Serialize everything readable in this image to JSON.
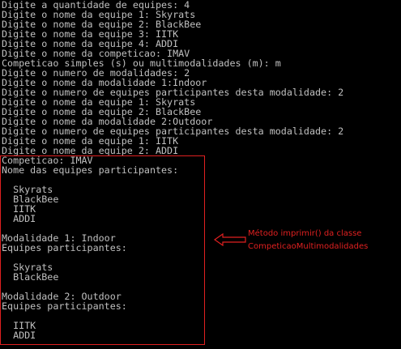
{
  "console": {
    "lines": [
      "Digite a quantidade de equipes: 4",
      "Digite o nome da equipe 1: Skyrats",
      "Digite o nome da equipe 2: BlackBee",
      "Digite o nome da equipe 3: IITK",
      "Digite o nome da equipe 4: ADDI",
      "Digite o nome da competicao: IMAV",
      "Competicao simples (s) ou multimodalidades (m): m",
      "Digite o numero de modalidades: 2",
      "Digite o nome da modalidade 1:Indoor",
      "Digite o numero de equipes participantes desta modalidade: 2",
      "Digite o nome da equipe 1: Skyrats",
      "Digite o nome da equipe 2: BlackBee",
      "Digite o nome da modalidade 2:Outdoor",
      "Digite o numero de equipes participantes desta modalidade: 2",
      "Digite o nome da equipe 1: IITK",
      "Digite o nome da equipe 2: ADDI",
      "Competicao: IMAV",
      "Nome das equipes participantes:",
      "",
      "  Skyrats",
      "  BlackBee",
      "  IITK",
      "  ADDI",
      "",
      "Modalidade 1: Indoor",
      "Equipes participantes:",
      "",
      "  Skyrats",
      "  BlackBee",
      "",
      "Modalidade 2: Outdoor",
      "Equipes participantes:",
      "",
      "  IITK",
      "  ADDI"
    ]
  },
  "annotation": {
    "line1": "Método imprimir() da classe",
    "line2": "CompeticaoMultimodalidades"
  },
  "colors": {
    "background": "#000000",
    "text": "#c0c0c0",
    "annotation": "#e02020"
  }
}
